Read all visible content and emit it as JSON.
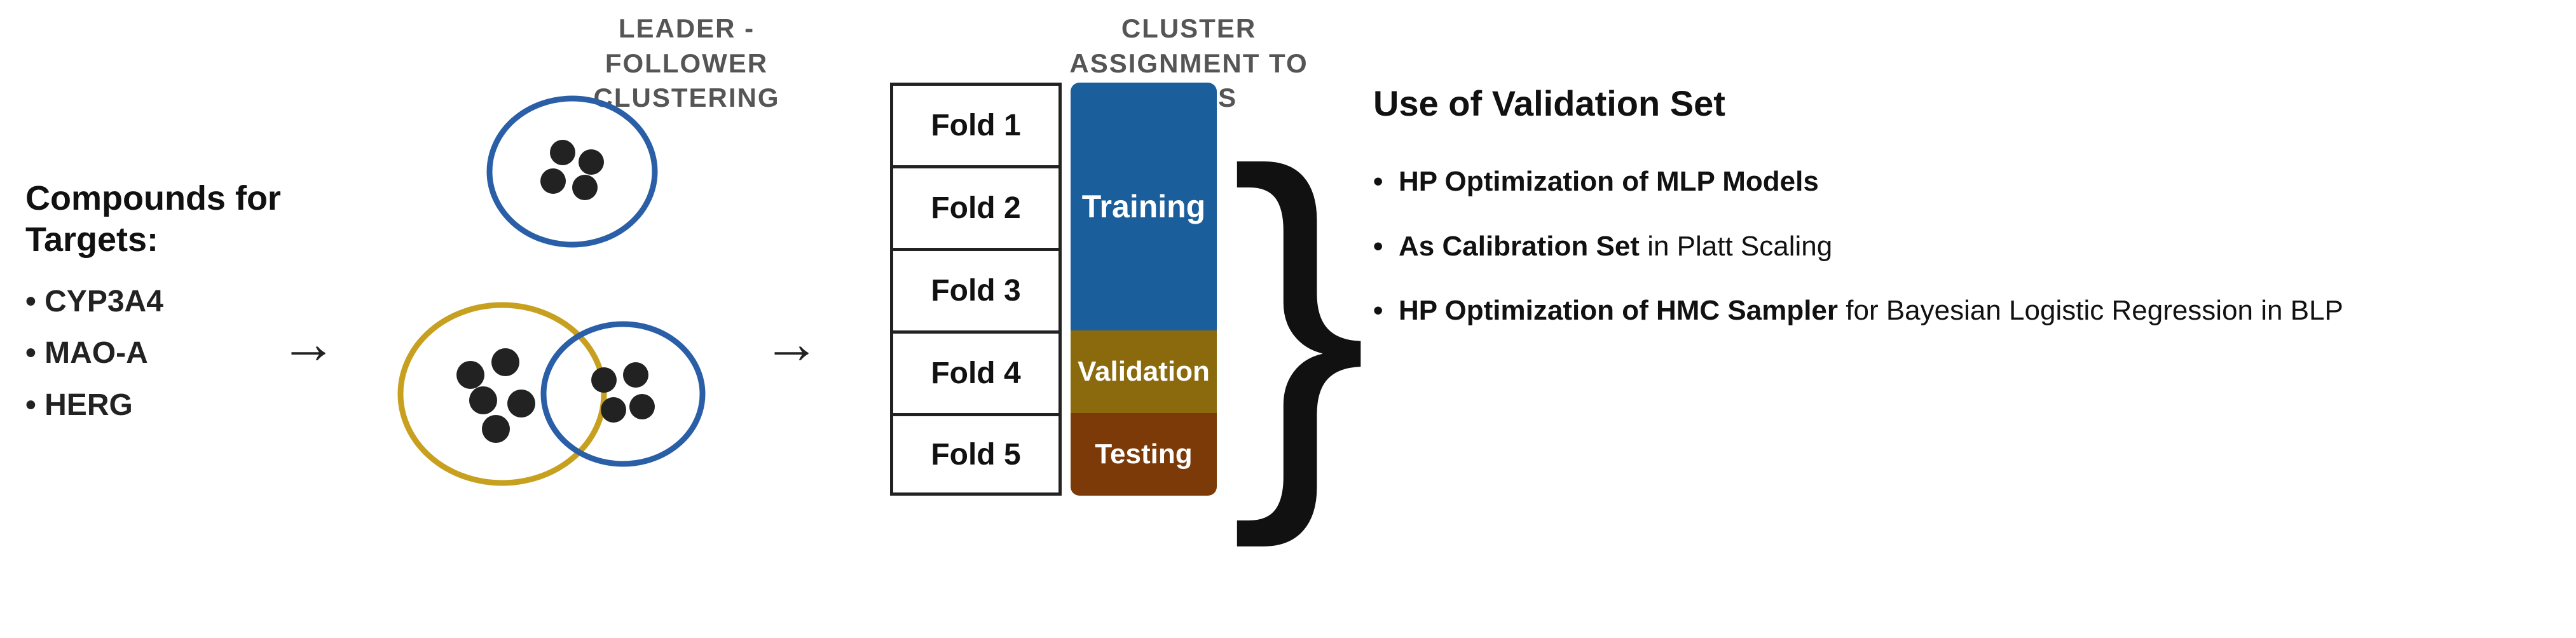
{
  "header": {
    "clustering_label_line1": "LEADER - FOLLOWER",
    "clustering_label_line2": "CLUSTERING",
    "assignment_label_line1": "CLUSTER",
    "assignment_label_line2": "ASSIGNMENT TO FOLDS"
  },
  "compounds": {
    "title_line1": "Compounds for",
    "title_line2": "Targets:",
    "items": [
      "• CYP3A4",
      "• MAO-A",
      "• HERG"
    ]
  },
  "folds": {
    "items": [
      "Fold 1",
      "Fold 2",
      "Fold 3",
      "Fold 4",
      "Fold 5"
    ],
    "labels": {
      "training": "Training",
      "validation": "Validation",
      "testing": "Testing"
    }
  },
  "validation_use": {
    "title": "Use of Validation Set",
    "items": [
      {
        "bullet": "•",
        "bold": "HP Optimization of MLP Models"
      },
      {
        "bullet": "•",
        "bold": "As Calibration Set",
        "normal": " in Platt Scaling"
      },
      {
        "bullet": "•",
        "bold": "HP Optimization of HMC Sampler",
        "normal": " for Bayesian Logistic Regression in BLP"
      }
    ]
  },
  "colors": {
    "training_bg": "#1b5e9c",
    "validation_bg": "#8b6a0d",
    "testing_bg": "#7b3a08",
    "cluster_blue": "#2a5fa8",
    "cluster_yellow": "#c8a020"
  }
}
